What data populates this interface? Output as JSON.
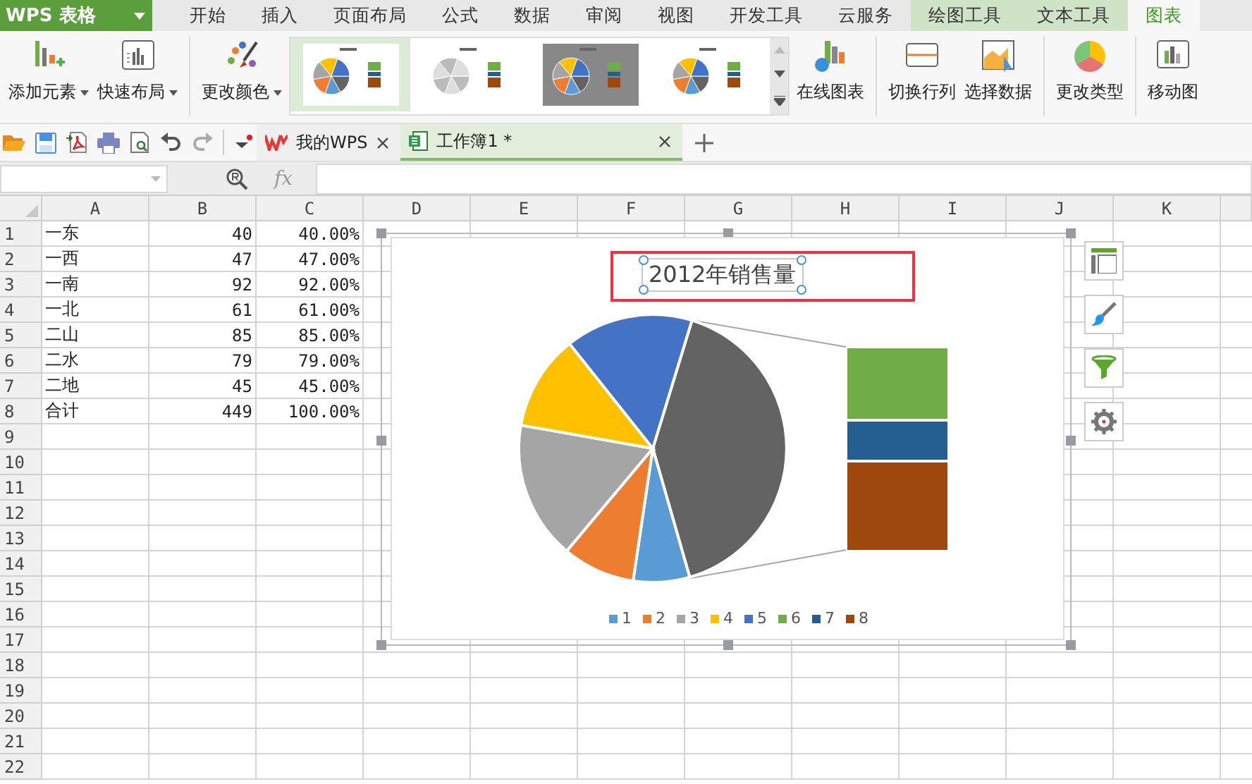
{
  "app_menu": {
    "label": "WPS 表格"
  },
  "menu_tabs": [
    {
      "label": "开始",
      "selected": false,
      "contextual": false
    },
    {
      "label": "插入",
      "selected": false,
      "contextual": false
    },
    {
      "label": "页面布局",
      "selected": false,
      "contextual": false
    },
    {
      "label": "公式",
      "selected": false,
      "contextual": false
    },
    {
      "label": "数据",
      "selected": false,
      "contextual": false
    },
    {
      "label": "审阅",
      "selected": false,
      "contextual": false
    },
    {
      "label": "视图",
      "selected": false,
      "contextual": false
    },
    {
      "label": "开发工具",
      "selected": false,
      "contextual": false
    },
    {
      "label": "云服务",
      "selected": false,
      "contextual": false
    },
    {
      "label": "绘图工具",
      "selected": false,
      "contextual": true
    },
    {
      "label": "文本工具",
      "selected": false,
      "contextual": true
    },
    {
      "label": "图表",
      "selected": true,
      "contextual": true
    }
  ],
  "ribbon": {
    "left_buttons": [
      {
        "label": "添加元素",
        "kind": "add"
      },
      {
        "label": "快速布局",
        "kind": "layout"
      },
      {
        "label": "更改颜色",
        "kind": "color"
      }
    ],
    "chart_styles": [
      {
        "selected": true
      },
      {
        "selected": false
      },
      {
        "selected": false
      },
      {
        "selected": false
      }
    ],
    "right_buttons": [
      {
        "label": "在线图表",
        "kind": "online"
      },
      {
        "label": "切换行列",
        "kind": "switch"
      },
      {
        "label": "选择数据",
        "kind": "select"
      },
      {
        "label": "更改类型",
        "kind": "type"
      },
      {
        "label": "移动图",
        "kind": "move"
      }
    ]
  },
  "doc_tabs": [
    {
      "label": "我的WPS",
      "selected": false,
      "kind": "home"
    },
    {
      "label": "工作簿1 *",
      "selected": true,
      "kind": "sheet"
    }
  ],
  "formula_bar": {
    "fx": "fx"
  },
  "sheet": {
    "columns": [
      "A",
      "B",
      "C",
      "D",
      "E",
      "F",
      "G",
      "H",
      "I",
      "J",
      "K"
    ],
    "rows": [
      {
        "number": "1",
        "cells": [
          "一东",
          "40",
          "40.00%"
        ]
      },
      {
        "number": "2",
        "cells": [
          "一西",
          "47",
          "47.00%"
        ]
      },
      {
        "number": "3",
        "cells": [
          "一南",
          "92",
          "92.00%"
        ]
      },
      {
        "number": "4",
        "cells": [
          "一北",
          "61",
          "61.00%"
        ]
      },
      {
        "number": "5",
        "cells": [
          "二山",
          "85",
          "85.00%"
        ]
      },
      {
        "number": "6",
        "cells": [
          "二水",
          "79",
          "79.00%"
        ]
      },
      {
        "number": "7",
        "cells": [
          "二地",
          "45",
          "45.00%"
        ]
      },
      {
        "number": "8",
        "cells": [
          "合计",
          "449",
          "100.00%"
        ]
      },
      {
        "number": "9",
        "cells": []
      },
      {
        "number": "10",
        "cells": []
      },
      {
        "number": "11",
        "cells": []
      },
      {
        "number": "12",
        "cells": []
      },
      {
        "number": "13",
        "cells": []
      },
      {
        "number": "14",
        "cells": []
      },
      {
        "number": "15",
        "cells": []
      },
      {
        "number": "16",
        "cells": []
      },
      {
        "number": "17",
        "cells": []
      },
      {
        "number": "18",
        "cells": []
      },
      {
        "number": "19",
        "cells": []
      },
      {
        "number": "20",
        "cells": []
      },
      {
        "number": "21",
        "cells": []
      },
      {
        "number": "22",
        "cells": []
      }
    ]
  },
  "chart": {
    "title": "2012年销售量",
    "title_highlighted": true,
    "legend": [
      {
        "label": "1",
        "color": "#5b9bd5"
      },
      {
        "label": "2",
        "color": "#ed7d31"
      },
      {
        "label": "3",
        "color": "#a5a5a5"
      },
      {
        "label": "4",
        "color": "#ffc000"
      },
      {
        "label": "5",
        "color": "#4472c4"
      },
      {
        "label": "6",
        "color": "#70ad47"
      },
      {
        "label": "7",
        "color": "#255e91"
      },
      {
        "label": "8",
        "color": "#9e480e"
      }
    ]
  }
}
